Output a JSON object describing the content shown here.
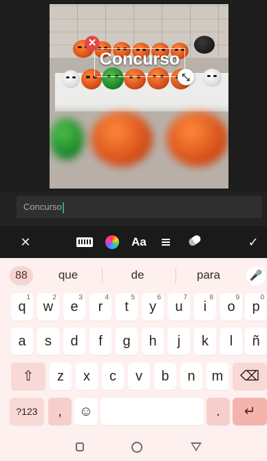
{
  "editor": {
    "overlay_text": "Concurso",
    "close_handle_glyph": "✕",
    "resize_handle_glyph": "⤡"
  },
  "text_input": {
    "value": "Concurso"
  },
  "text_toolbar": {
    "close_glyph": "✕",
    "keyboard_icon": "keyboard-icon",
    "color_icon": "color-wheel-icon",
    "font_label": "Aa",
    "align_icon": "align-left-icon",
    "eraser_icon": "eraser-icon",
    "done_glyph": "✓"
  },
  "keyboard": {
    "suggestions": [
      "que",
      "de",
      "para"
    ],
    "grid_glyph": "88",
    "mic_glyph": "🎤",
    "row1": [
      {
        "k": "q",
        "h": "1"
      },
      {
        "k": "w",
        "h": "2"
      },
      {
        "k": "e",
        "h": "3"
      },
      {
        "k": "r",
        "h": "4"
      },
      {
        "k": "t",
        "h": "5"
      },
      {
        "k": "y",
        "h": "6"
      },
      {
        "k": "u",
        "h": "7"
      },
      {
        "k": "i",
        "h": "8"
      },
      {
        "k": "o",
        "h": "9"
      },
      {
        "k": "p",
        "h": "0"
      }
    ],
    "row2": [
      "a",
      "s",
      "d",
      "f",
      "g",
      "h",
      "j",
      "k",
      "l",
      "ñ"
    ],
    "row3": [
      "z",
      "x",
      "c",
      "v",
      "b",
      "n",
      "m"
    ],
    "shift_glyph": "⇧",
    "backspace_glyph": "⌫",
    "symbols_label": "?123",
    "comma": ",",
    "emoji_glyph": "☺",
    "period": ".",
    "enter_glyph": "↵"
  },
  "colors": {
    "accent_caret": "#1db38a",
    "keyboard_bg": "#fdf0ee",
    "enter_key": "#f4b3ac"
  }
}
